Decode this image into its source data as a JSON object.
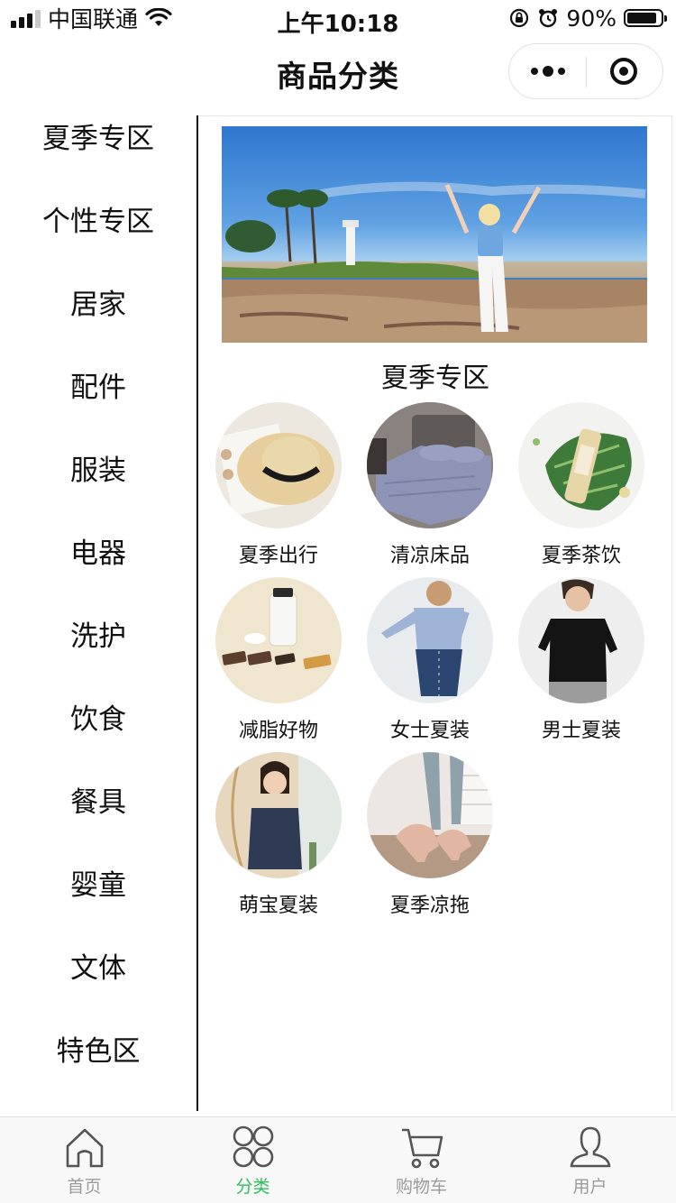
{
  "status_bar": {
    "carrier": "中国联通",
    "time": "上午10:18",
    "battery": "90%",
    "battery_level": 0.9
  },
  "nav": {
    "title": "商品分类"
  },
  "categories": [
    "夏季专区",
    "个性专区",
    "居家",
    "配件",
    "服装",
    "电器",
    "洗护",
    "饮食",
    "餐具",
    "婴童",
    "文体",
    "特色区"
  ],
  "content": {
    "section_title": "夏季专区",
    "products": [
      {
        "label": "夏季出行",
        "icon": "straw-hat-image"
      },
      {
        "label": "清凉床品",
        "icon": "bedding-image"
      },
      {
        "label": "夏季茶饮",
        "icon": "ginger-ale-image"
      },
      {
        "label": "减脂好物",
        "icon": "snack-bar-image"
      },
      {
        "label": "女士夏装",
        "icon": "womens-shirt-image"
      },
      {
        "label": "男士夏装",
        "icon": "mens-tee-image"
      },
      {
        "label": "萌宝夏装",
        "icon": "kids-wear-image"
      },
      {
        "label": "夏季凉拖",
        "icon": "sandals-image"
      }
    ]
  },
  "tabbar": {
    "active": "分类",
    "active_color": "#2dbd5f",
    "inactive_color": "#9b9b9b",
    "tabs": [
      {
        "label": "首页",
        "icon": "home-icon"
      },
      {
        "label": "分类",
        "icon": "grid-icon"
      },
      {
        "label": "购物车",
        "icon": "cart-icon"
      },
      {
        "label": "用户",
        "icon": "user-icon"
      }
    ]
  }
}
